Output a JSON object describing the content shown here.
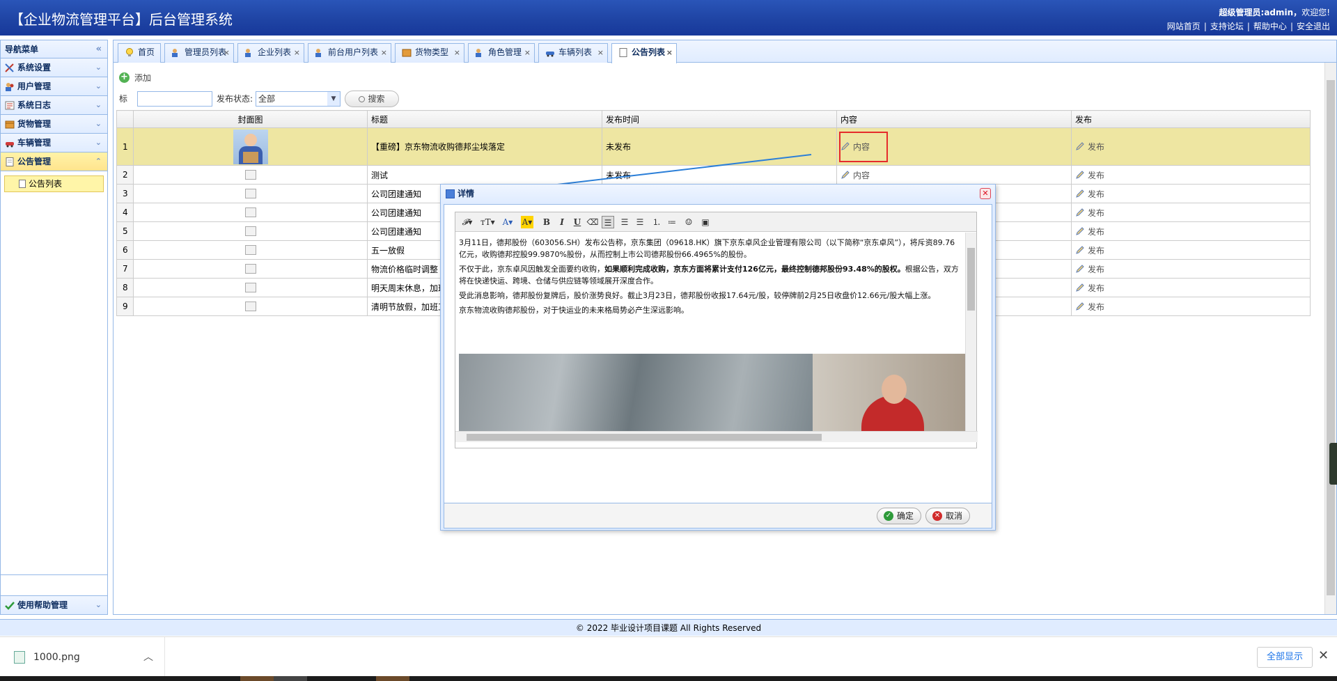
{
  "header": {
    "title": "【企业物流管理平台】后台管理系统",
    "welcome_user": "超级管理员:admin，",
    "welcome_greet": "欢迎您!",
    "links": [
      "网站首页",
      "支持论坛",
      "帮助中心",
      "安全退出"
    ]
  },
  "sidebar": {
    "heading": "导航菜单",
    "items": [
      {
        "label": "系统设置"
      },
      {
        "label": "用户管理"
      },
      {
        "label": "系统日志"
      },
      {
        "label": "货物管理"
      },
      {
        "label": "车辆管理"
      },
      {
        "label": "公告管理"
      }
    ],
    "sub_item": "公告列表",
    "bottom_item": "使用帮助管理"
  },
  "tabs": [
    {
      "label": "首页"
    },
    {
      "label": "管理员列表"
    },
    {
      "label": "企业列表"
    },
    {
      "label": "前台用户列表"
    },
    {
      "label": "货物类型"
    },
    {
      "label": "角色管理"
    },
    {
      "label": "车辆列表"
    },
    {
      "label": "公告列表"
    }
  ],
  "toolbar": {
    "add_label": "添加"
  },
  "search": {
    "title_label": "标题:",
    "status_label": "发布状态:",
    "status_value": "全部",
    "search_button": "搜索"
  },
  "grid": {
    "columns": [
      "封面图",
      "标题",
      "发布时间",
      "内容",
      "发布"
    ],
    "content_link": "内容",
    "publish_link": "发布",
    "rows": [
      {
        "no": "1",
        "title": "【重磅】京东物流收购德邦尘埃落定",
        "time": "未发布"
      },
      {
        "no": "2",
        "title": "测试",
        "time": "未发布"
      },
      {
        "no": "3",
        "title": "公司团建通知",
        "time": ""
      },
      {
        "no": "4",
        "title": "公司团建通知",
        "time": ""
      },
      {
        "no": "5",
        "title": "公司团建通知",
        "time": ""
      },
      {
        "no": "6",
        "title": "五一放假",
        "time": ""
      },
      {
        "no": "7",
        "title": "物流价格临时调整",
        "time": ""
      },
      {
        "no": "8",
        "title": "明天周末休息，加班",
        "time": ""
      },
      {
        "no": "9",
        "title": "清明节放假，加班工",
        "time": ""
      }
    ]
  },
  "dialog": {
    "title": "详情",
    "paragraphs": [
      "3月11日，德邦股份（603056.SH）发布公告称，京东集团（09618.HK）旗下京东卓风企业管理有限公司（以下简称“京东卓风”），将斥资89.76亿元，收购德邦控股99.9870%股份，从而控制上市公司德邦股份66.4965%的股份。",
      "受此消息影响，德邦股份复牌后，股价涨势良好。截止3月23日，德邦股份收报17.64元/股，较停牌前2月25日收盘价12.66元/股大幅上涨。",
      "京东物流收购德邦股份，对于快运业的未来格局势必产生深远影响。"
    ],
    "p2_start": "不仅于此，京东卓风因触发全面要约收购，",
    "p2_bold": "如果顺利完成收购，京东方面将累计支付126亿元，最终控制德邦股份93.48%的股权。",
    "p2_end": "根据公告，双方将在快递快运、跨境、仓储与供应链等领域展开深度合作。",
    "ok_button": "确定",
    "cancel_button": "取消"
  },
  "footer": {
    "copyright": "© 2022 毕业设计项目课题 All Rights Reserved"
  },
  "download": {
    "filename": "1000.png",
    "show_all": "全部显示"
  },
  "colors": {
    "header": "#1f44a4",
    "panel_border": "#95b8e7",
    "selected_row": "#eee6a2",
    "highlight": "#e52b2b"
  }
}
